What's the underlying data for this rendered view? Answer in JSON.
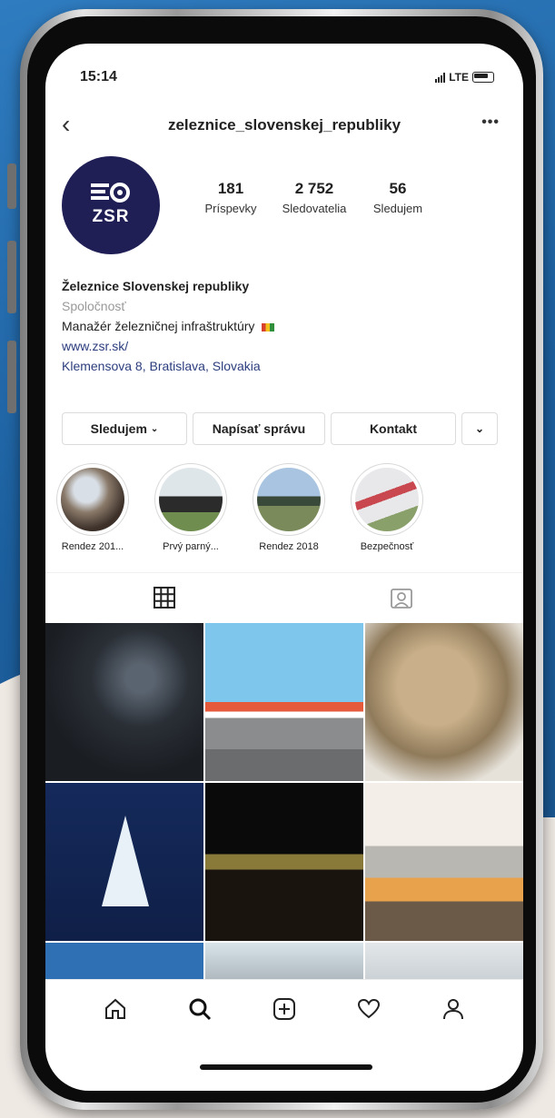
{
  "status": {
    "time": "15:14",
    "network": "LTE"
  },
  "header": {
    "username": "zeleznice_slovenskej_republiky",
    "back_icon": "chevron-left-icon",
    "more_icon": "ellipsis-icon"
  },
  "profile": {
    "avatar_text": "ZSR",
    "stats": [
      {
        "value": "181",
        "label": "Príspevky"
      },
      {
        "value": "2 752",
        "label": "Sledovatelia"
      },
      {
        "value": "56",
        "label": "Sledujem"
      }
    ],
    "name": "Železnice Slovenskej republiky",
    "category": "Spoločnosť",
    "description": "Manažér železničnej infraštruktúry",
    "website": "www.zsr.sk/",
    "address": "Klemensova 8, Bratislava, Slovakia"
  },
  "actions": {
    "follow": "Sledujem",
    "message": "Napísať správu",
    "contact": "Kontakt"
  },
  "highlights": [
    {
      "label": "Rendez 201..."
    },
    {
      "label": "Prvý parný..."
    },
    {
      "label": "Rendez 2018"
    },
    {
      "label": "Bezpečnosť"
    }
  ],
  "tabs": [
    "grid-icon",
    "tagged-icon"
  ],
  "bottom_nav": [
    "home-icon",
    "search-icon",
    "new-post-icon",
    "heart-icon",
    "profile-icon"
  ],
  "colors": {
    "accent_link": "#2c3d7e",
    "avatar_bg": "#1f1e55"
  }
}
